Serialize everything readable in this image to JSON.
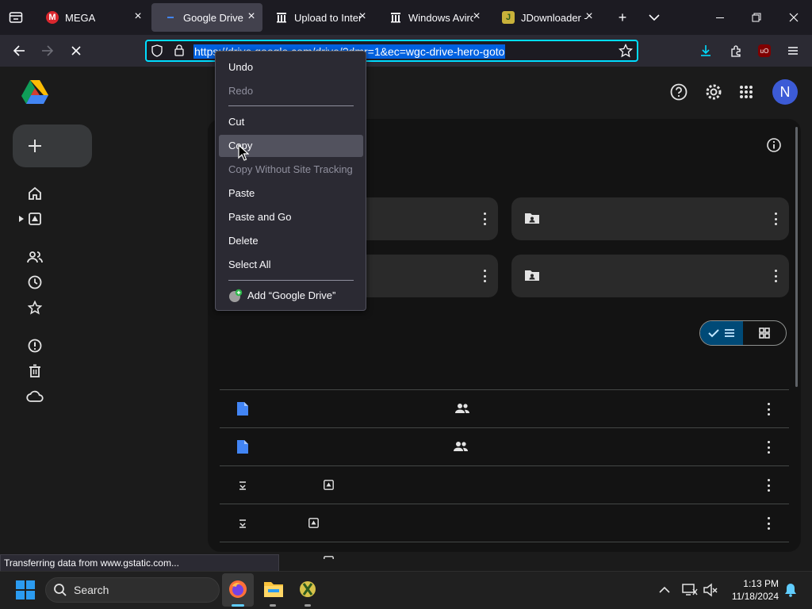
{
  "browser": {
    "tabs": [
      {
        "title": "MEGA",
        "favicon": "mega-icon"
      },
      {
        "title": "Google Drive",
        "favicon": "google-drive-icon",
        "active": true
      },
      {
        "title": "Upload to Interr",
        "favicon": "archive-icon"
      },
      {
        "title": "Windows Aviro",
        "favicon": "archive-icon"
      },
      {
        "title": "JDownloader - C",
        "favicon": "jdownloader-icon"
      }
    ],
    "url": "https://drive.google.com/drive/?dmr=1&ec=wgc-drive-hero-goto"
  },
  "context_menu": {
    "items": [
      {
        "label": "Undo",
        "enabled": true
      },
      {
        "label": "Redo",
        "enabled": false
      },
      {
        "label": "Cut",
        "enabled": true
      },
      {
        "label": "Copy",
        "enabled": true,
        "hovered": true
      },
      {
        "label": "Copy Without Site Tracking",
        "enabled": false
      },
      {
        "label": "Paste",
        "enabled": true
      },
      {
        "label": "Paste and Go",
        "enabled": true
      },
      {
        "label": "Delete",
        "enabled": true
      },
      {
        "label": "Select All",
        "enabled": true
      },
      {
        "label": "Add “Google Drive”",
        "enabled": true
      }
    ]
  },
  "drive": {
    "avatar_letter": "N"
  },
  "status_bar": "Transferring data from www.gstatic.com...",
  "taskbar": {
    "search_placeholder": "Search",
    "time": "1:13 PM",
    "date": "11/18/2024"
  },
  "colors": {
    "accent": "#00ddff",
    "selection": "#0061e0",
    "avatar": "#3c5bd6",
    "file_blue": "#4285f4"
  }
}
